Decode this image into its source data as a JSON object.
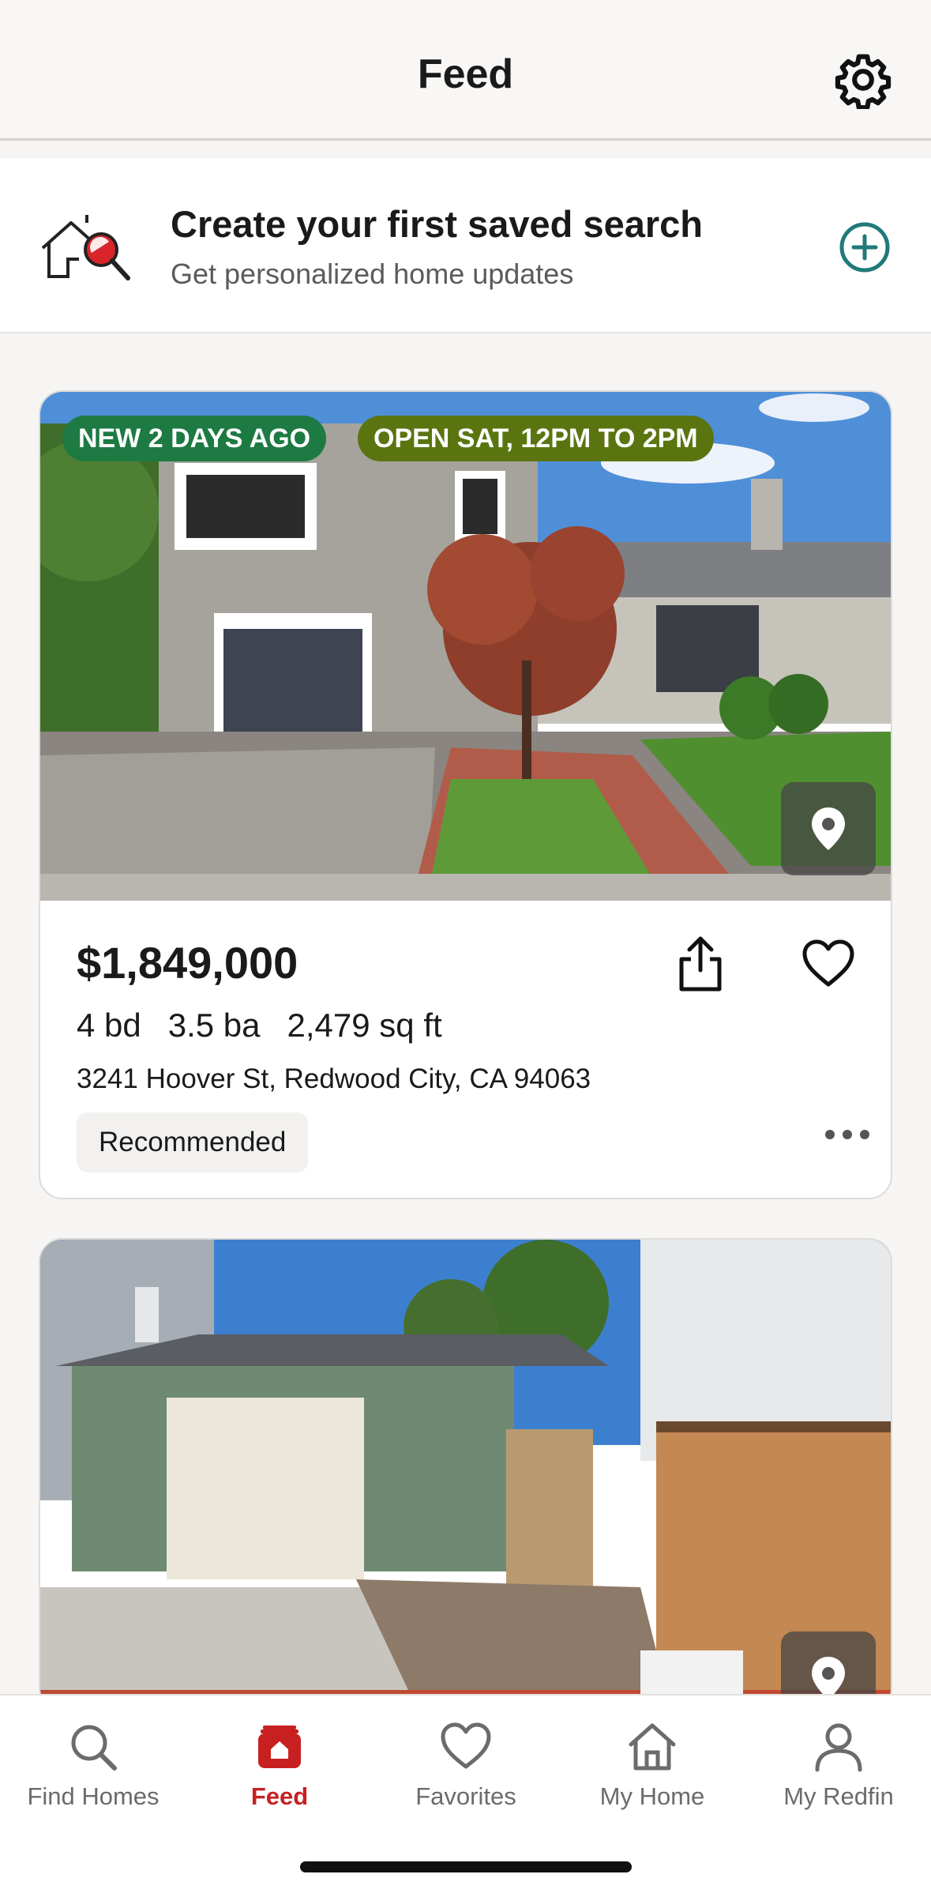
{
  "header": {
    "title": "Feed",
    "settings_icon": "gear-icon"
  },
  "banner": {
    "title": "Create your first saved search",
    "subtitle": "Get personalized home updates",
    "icon": "house-search-icon",
    "action_icon": "plus-circle-icon"
  },
  "listings": [
    {
      "badges": [
        "NEW 2 DAYS AGO",
        "OPEN SAT, 12PM TO 2PM"
      ],
      "price": "$1,849,000",
      "beds": "4 bd",
      "baths": "3.5 ba",
      "sqft": "2,479 sq ft",
      "address": "3241 Hoover St, Redwood City, CA 94063",
      "tag": "Recommended"
    },
    {
      "badges": [],
      "price": "",
      "address": ""
    }
  ],
  "tabbar": {
    "tabs": [
      {
        "label": "Find Homes",
        "icon": "search-icon"
      },
      {
        "label": "Feed",
        "icon": "feed-icon",
        "active": true
      },
      {
        "label": "Favorites",
        "icon": "heart-icon"
      },
      {
        "label": "My Home",
        "icon": "home-icon"
      },
      {
        "label": "My Redfin",
        "icon": "person-icon"
      }
    ]
  },
  "colors": {
    "accent": "#c82021",
    "new_badge": "#1c7a42",
    "open_badge": "#5a7510",
    "plus": "#1f7a78"
  }
}
